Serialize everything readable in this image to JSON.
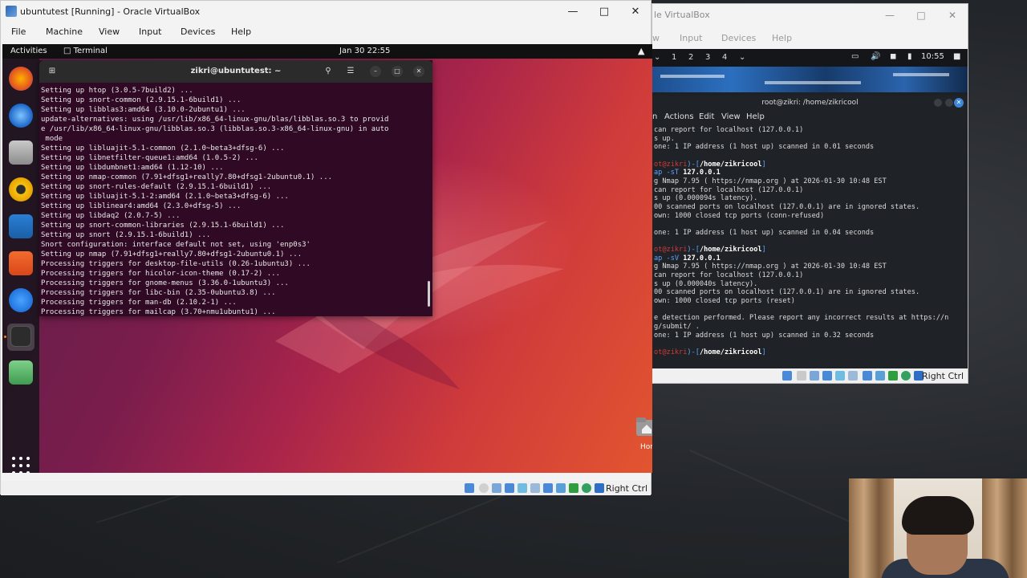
{
  "vb1": {
    "title": "ubuntutest [Running] - Oracle VirtualBox",
    "menu": [
      "File",
      "Machine",
      "View",
      "Input",
      "Devices",
      "Help"
    ],
    "status_right": "Right Ctrl"
  },
  "gnome": {
    "activities": "Activities",
    "app": "Terminal",
    "clock": "Jan 30  22:55"
  },
  "desktop": {
    "home_label": "Hon"
  },
  "uterm": {
    "title": "zikri@ubuntutest: ~",
    "lines": [
      "Setting up htop (3.0.5-7build2) ...",
      "Setting up snort-common (2.9.15.1-6build1) ...",
      "Setting up libblas3:amd64 (3.10.0-2ubuntu1) ...",
      "update-alternatives: using /usr/lib/x86_64-linux-gnu/blas/libblas.so.3 to provid",
      "e /usr/lib/x86_64-linux-gnu/libblas.so.3 (libblas.so.3-x86_64-linux-gnu) in auto",
      " mode",
      "Setting up libluajit-5.1-common (2.1.0~beta3+dfsg-6) ...",
      "Setting up libnetfilter-queue1:amd64 (1.0.5-2) ...",
      "Setting up libdumbnet1:amd64 (1.12-10) ...",
      "Setting up nmap-common (7.91+dfsg1+really7.80+dfsg1-2ubuntu0.1) ...",
      "Setting up snort-rules-default (2.9.15.1-6build1) ...",
      "Setting up libluajit-5.1-2:amd64 (2.1.0~beta3+dfsg-6) ...",
      "Setting up liblinear4:amd64 (2.3.0+dfsg-5) ...",
      "Setting up libdaq2 (2.0.7-5) ...",
      "Setting up snort-common-libraries (2.9.15.1-6build1) ...",
      "Setting up snort (2.9.15.1-6build1) ...",
      "Snort configuration: interface default not set, using 'enp0s3'",
      "Setting up nmap (7.91+dfsg1+really7.80+dfsg1-2ubuntu0.1) ...",
      "Processing triggers for desktop-file-utils (0.26-1ubuntu3) ...",
      "Processing triggers for hicolor-icon-theme (0.17-2) ...",
      "Processing triggers for gnome-menus (3.36.0-1ubuntu3) ...",
      "Processing triggers for libc-bin (2.35-0ubuntu3.8) ...",
      "Processing triggers for man-db (2.10.2-1) ...",
      "Processing triggers for mailcap (3.70+nmu1ubuntu1) ..."
    ]
  },
  "vb2": {
    "title": "le VirtualBox",
    "menu": [
      "w",
      "Input",
      "Devices",
      "Help"
    ],
    "status_right": "Right Ctrl"
  },
  "kali": {
    "workspaces": [
      "1",
      "2",
      "3",
      "4"
    ],
    "clock": "10:55",
    "term_title": "root@zikri: /home/zikricool",
    "term_menu": [
      "n",
      "Actions",
      "Edit",
      "View",
      "Help"
    ],
    "lines": [
      {
        "t": "can report for localhost (127.0.0.1)"
      },
      {
        "t": "s up."
      },
      {
        "t": "one: 1 IP address (1 host up) scanned in 0.01 seconds"
      },
      {
        "t": ""
      },
      {
        "r": "ot@zikri",
        "b": "/home/zikricool",
        "mid": ")-[",
        "end": "]"
      },
      {
        "c": "ap -sT",
        "rest": " 127.0.0.1"
      },
      {
        "t": "g Nmap 7.95 ( https://nmap.org ) at 2026-01-30 10:48 EST"
      },
      {
        "t": "can report for localhost (127.0.0.1)"
      },
      {
        "t": "s up (0.000094s latency)."
      },
      {
        "t": "00 scanned ports on localhost (127.0.0.1) are in ignored states."
      },
      {
        "t": "own: 1000 closed tcp ports (conn-refused)"
      },
      {
        "t": ""
      },
      {
        "t": "one: 1 IP address (1 host up) scanned in 0.04 seconds"
      },
      {
        "t": ""
      },
      {
        "r": "ot@zikri",
        "b": "/home/zikricool",
        "mid": ")-[",
        "end": "]"
      },
      {
        "c": "ap -sV",
        "rest": " 127.0.0.1"
      },
      {
        "t": "g Nmap 7.95 ( https://nmap.org ) at 2026-01-30 10:48 EST"
      },
      {
        "t": "can report for localhost (127.0.0.1)"
      },
      {
        "t": "s up (0.000040s latency)."
      },
      {
        "t": "00 scanned ports on localhost (127.0.0.1) are in ignored states."
      },
      {
        "t": "own: 1000 closed tcp ports (reset)"
      },
      {
        "t": ""
      },
      {
        "t": "e detection performed. Please report any incorrect results at https://n"
      },
      {
        "t": "g/submit/ ."
      },
      {
        "t": "one: 1 IP address (1 host up) scanned in 0.32 seconds"
      },
      {
        "t": ""
      },
      {
        "r": "ot@zikri",
        "b": "/home/zikricool",
        "mid": ")-[",
        "end": "]"
      }
    ]
  },
  "colors": {
    "ubuntu_term_bg": "#300a24",
    "kali_red": "#d43a3a",
    "kali_blue": "#5fa3ff"
  }
}
